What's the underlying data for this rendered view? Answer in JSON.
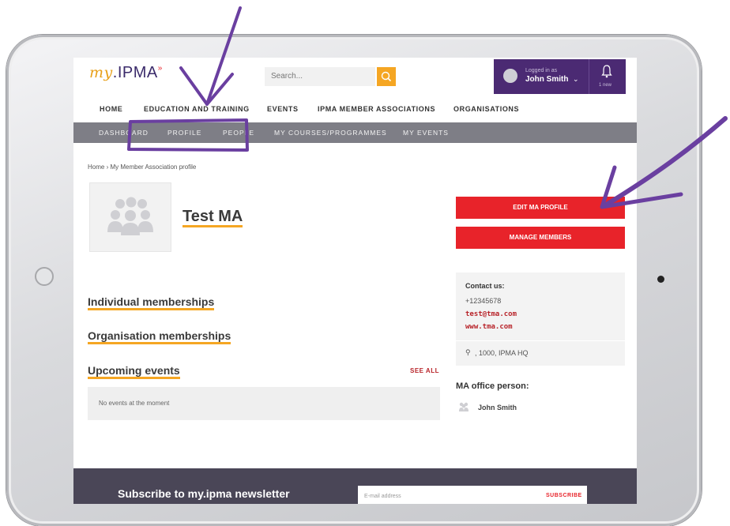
{
  "header": {
    "logo_my": "my",
    "logo_ipma": ".IPMA",
    "logo_mark": "»",
    "search_placeholder": "Search...",
    "logged_in_as": "Logged in as",
    "user_name": "John Smith",
    "notifications": "1 new"
  },
  "main_nav": [
    "HOME",
    "EDUCATION AND TRAINING",
    "EVENTS",
    "IPMA MEMBER ASSOCIATIONS",
    "ORGANISATIONS"
  ],
  "sub_nav": [
    "DASHBOARD",
    "PROFILE",
    "PEOPLE",
    "MY COURSES/PROGRAMMES",
    "MY EVENTS"
  ],
  "breadcrumb": "Home  ›  My Member Association profile",
  "profile": {
    "name": "Test MA"
  },
  "actions": {
    "edit": "EDIT MA PROFILE",
    "manage": "MANAGE MEMBERS"
  },
  "contact": {
    "title": "Contact us:",
    "phone": "+12345678",
    "email": "test@tma.com",
    "website": "www.tma.com",
    "address": ", 1000, IPMA HQ"
  },
  "office": {
    "title": "MA office person:",
    "person": "John Smith"
  },
  "sections": {
    "individual": "Individual memberships",
    "organisation": "Organisation memberships",
    "upcoming": "Upcoming events",
    "see_all": "SEE ALL",
    "no_events": "No events at the moment"
  },
  "newsletter": {
    "title": "Subscribe to my.ipma newsletter",
    "placeholder": "E-mail address",
    "button": "SUBSCRIBE"
  },
  "colors": {
    "accent_purple": "#4b2a73",
    "accent_orange": "#f5a623",
    "brand_red": "#e8232a",
    "annotation_purple": "#6a3fa0"
  }
}
